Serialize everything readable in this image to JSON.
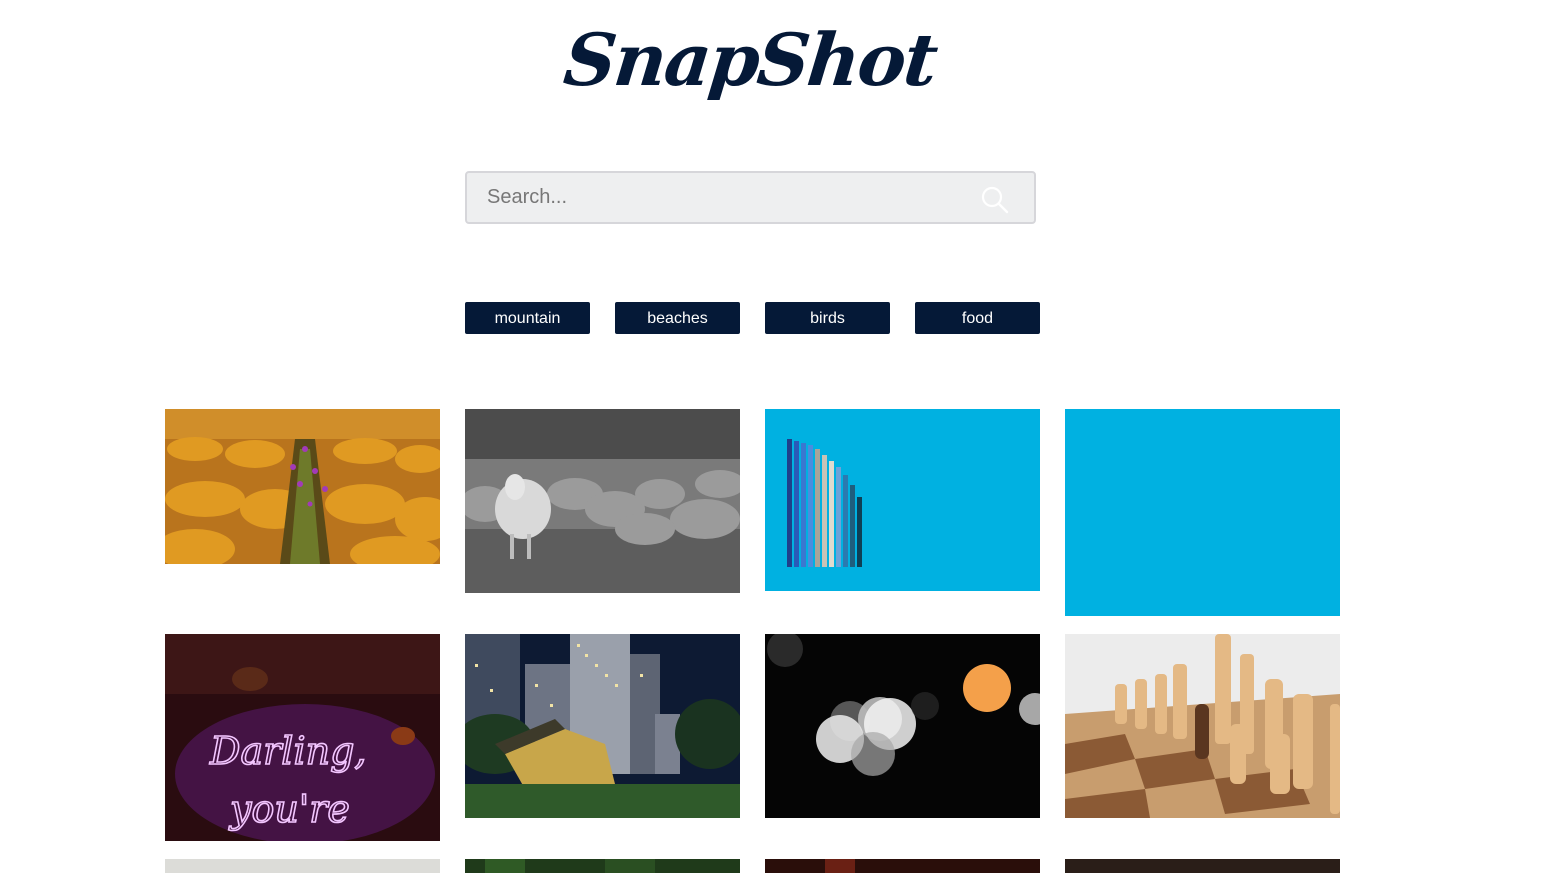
{
  "app": {
    "logo_text": "SnapShot"
  },
  "search": {
    "placeholder": "Search...",
    "value": "",
    "icon": "search-icon"
  },
  "tags": [
    {
      "label": "mountain"
    },
    {
      "label": "beaches"
    },
    {
      "label": "birds"
    },
    {
      "label": "food"
    }
  ],
  "gallery": [
    {
      "subject": "orange flower field with purple flowers"
    },
    {
      "subject": "black and white sheep flock"
    },
    {
      "subject": "blue colored pencils on blue background"
    },
    {
      "subject": "plain blue"
    },
    {
      "subject": "neon sign reading Darling, you're",
      "neon_text_line1": "Darling,",
      "neon_text_line2": "you're"
    },
    {
      "subject": "tilted yellow house in front of city towers at night"
    },
    {
      "subject": "bokeh lights on black background"
    },
    {
      "subject": "wooden chess pieces on chessboard"
    }
  ],
  "colors": {
    "brand": "#051937",
    "search_bg": "#eeeff0",
    "search_border": "#d6d6da",
    "tag_text": "#ffffff"
  }
}
